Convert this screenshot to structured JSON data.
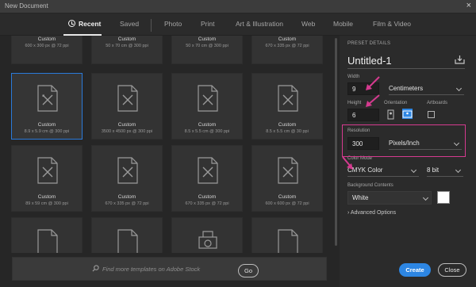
{
  "window": {
    "title": "New Document",
    "close_glyph": "×"
  },
  "tabs": [
    {
      "label": "Recent",
      "active": true
    },
    {
      "label": "Saved"
    },
    {
      "label": "Photo"
    },
    {
      "label": "Print"
    },
    {
      "label": "Art & Illustration"
    },
    {
      "label": "Web"
    },
    {
      "label": "Mobile"
    },
    {
      "label": "Film & Video"
    }
  ],
  "templates": [
    {
      "name": "",
      "size": "600 x 300 px @ 72 ppi"
    },
    {
      "name": "",
      "size": "50 x 70 cm @ 300 ppi"
    },
    {
      "name": "",
      "size": "50 x 70 cm @ 300 ppi"
    },
    {
      "name": "",
      "size": "670 x 335 px @ 72 ppi"
    },
    {
      "name": "Custom",
      "size": "8.9 x 5.9 cm @ 300 ppi",
      "selected": true
    },
    {
      "name": "Custom",
      "size": "3500 x 4500 px @ 300 ppi"
    },
    {
      "name": "Custom",
      "size": "8.5 x 5.5 cm @ 300 ppi"
    },
    {
      "name": "Custom",
      "size": "8.5 x 5.5 cm @ 30 ppi"
    },
    {
      "name": "Custom",
      "size": "89 x 59 cm @ 300 ppi"
    },
    {
      "name": "Custom",
      "size": "670 x 335 px @ 72 ppi"
    },
    {
      "name": "Custom",
      "size": "670 x 335 px @ 72 ppi"
    },
    {
      "name": "Custom",
      "size": "600 x 600 px @ 72 ppi"
    }
  ],
  "top_row_names": [
    "Custom",
    "Custom",
    "Custom",
    "Custom"
  ],
  "search": {
    "placeholder": "Find more templates on Adobe Stock",
    "go_label": "Go"
  },
  "preset": {
    "section_title": "PRESET DETAILS",
    "document_name": "Untitled-1",
    "width_label": "Width",
    "width_value": "9",
    "width_unit": "Centimeters",
    "height_label": "Height",
    "height_value": "6",
    "orientation_label": "Orientation",
    "artboards_label": "Artboards",
    "resolution_label": "Resolution",
    "resolution_value": "300",
    "resolution_unit": "Pixels/Inch",
    "color_mode_label": "Color Mode",
    "color_mode_value": "CMYK Color",
    "bit_depth_value": "8 bit",
    "background_label": "Background Contents",
    "background_value": "White",
    "background_color": "#ffffff",
    "advanced_label": "Advanced Options",
    "advanced_glyph": "›"
  },
  "buttons": {
    "create": "Create",
    "close": "Close"
  },
  "colors": {
    "accent": "#2d86e3",
    "highlight": "#d53a8f"
  }
}
